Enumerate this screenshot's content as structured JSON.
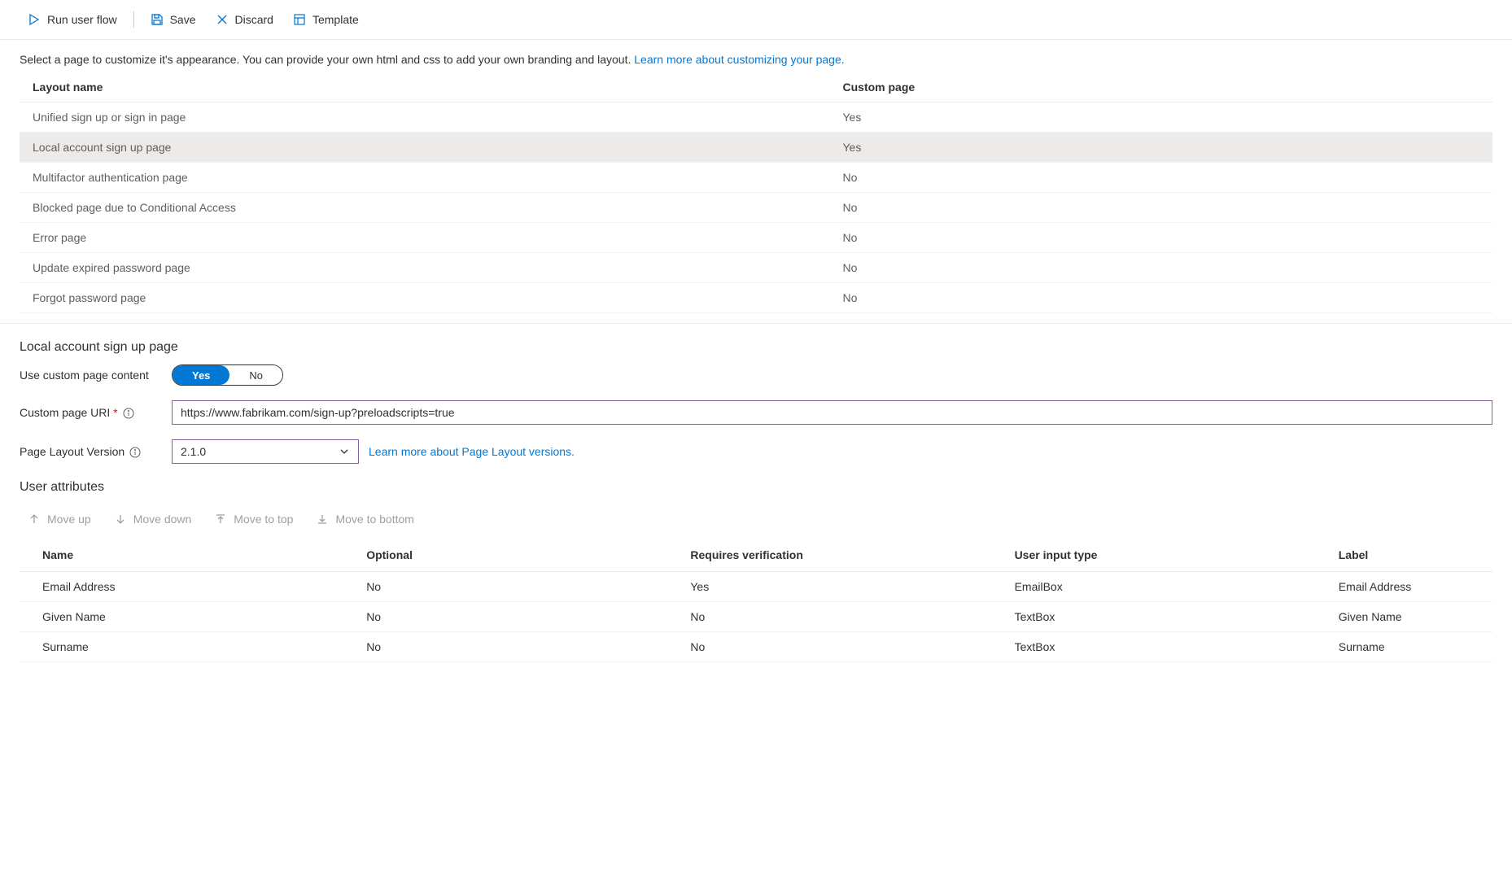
{
  "toolbar": {
    "run": "Run user flow",
    "save": "Save",
    "discard": "Discard",
    "template": "Template"
  },
  "intro": {
    "text": "Select a page to customize it's appearance. You can provide your own html and css to add your own branding and layout. ",
    "link": "Learn more about customizing your page."
  },
  "layoutTable": {
    "headers": {
      "name": "Layout name",
      "custom": "Custom page"
    },
    "rows": [
      {
        "name": "Unified sign up or sign in page",
        "custom": "Yes",
        "selected": false
      },
      {
        "name": "Local account sign up page",
        "custom": "Yes",
        "selected": true
      },
      {
        "name": "Multifactor authentication page",
        "custom": "No",
        "selected": false
      },
      {
        "name": "Blocked page due to Conditional Access",
        "custom": "No",
        "selected": false
      },
      {
        "name": "Error page",
        "custom": "No",
        "selected": false
      },
      {
        "name": "Update expired password page",
        "custom": "No",
        "selected": false
      },
      {
        "name": "Forgot password page",
        "custom": "No",
        "selected": false
      }
    ]
  },
  "detail": {
    "title": "Local account sign up page",
    "useCustomLabel": "Use custom page content",
    "toggle": {
      "yes": "Yes",
      "no": "No"
    },
    "uriLabel": "Custom page URI",
    "uriValue": "https://www.fabrikam.com/sign-up?preloadscripts=true",
    "versionLabel": "Page Layout Version",
    "versionValue": "2.1.0",
    "versionLink": "Learn more about Page Layout versions."
  },
  "attributes": {
    "title": "User attributes",
    "moveUp": "Move up",
    "moveDown": "Move down",
    "moveTop": "Move to top",
    "moveBottom": "Move to bottom",
    "headers": {
      "name": "Name",
      "optional": "Optional",
      "requires": "Requires verification",
      "inputType": "User input type",
      "label": "Label"
    },
    "rows": [
      {
        "name": "Email Address",
        "optional": "No",
        "requires": "Yes",
        "inputType": "EmailBox",
        "label": "Email Address"
      },
      {
        "name": "Given Name",
        "optional": "No",
        "requires": "No",
        "inputType": "TextBox",
        "label": "Given Name"
      },
      {
        "name": "Surname",
        "optional": "No",
        "requires": "No",
        "inputType": "TextBox",
        "label": "Surname"
      }
    ]
  }
}
